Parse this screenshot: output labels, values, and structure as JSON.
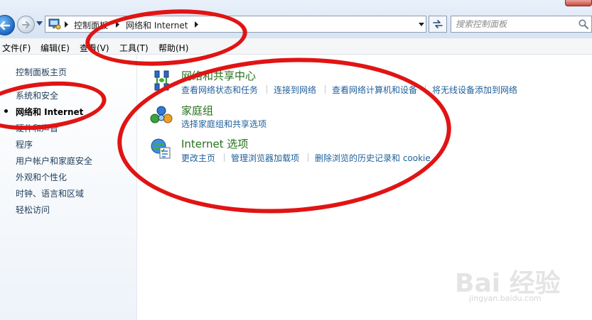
{
  "address_bar": {
    "breadcrumbs": [
      "控制面板",
      "网络和 Internet"
    ],
    "search_placeholder": "搜索控制面板"
  },
  "menu": [
    "文件(F)",
    "编辑(E)",
    "查看(V)",
    "工具(T)",
    "帮助(H)"
  ],
  "left_pane": {
    "items": [
      "控制面板主页",
      "系统和安全",
      "网络和 Internet",
      "硬件和声音",
      "程序",
      "用户帐户和家庭安全",
      "外观和个性化",
      "时钟、语言和区域",
      "轻松访问"
    ],
    "current_index": 2
  },
  "categories": [
    {
      "title": "网络和共享中心",
      "icon": "network-sharing-center-icon",
      "links": [
        "查看网络状态和任务",
        "连接到网络",
        "查看网络计算机和设备",
        "将无线设备添加到网络"
      ]
    },
    {
      "title": "家庭组",
      "icon": "homegroup-icon",
      "links": [
        "选择家庭组和共享选项"
      ]
    },
    {
      "title": "Internet 选项",
      "icon": "internet-options-icon",
      "links": [
        "更改主页",
        "管理浏览器加载项",
        "删除浏览的历史记录和 cookie"
      ]
    }
  ],
  "watermark": {
    "logo": "Bai 经验",
    "url": "jingyan.baidu.com"
  },
  "colors": {
    "link": "#1f5f9a",
    "category_title": "#26701c",
    "annotation": "#e11414"
  }
}
